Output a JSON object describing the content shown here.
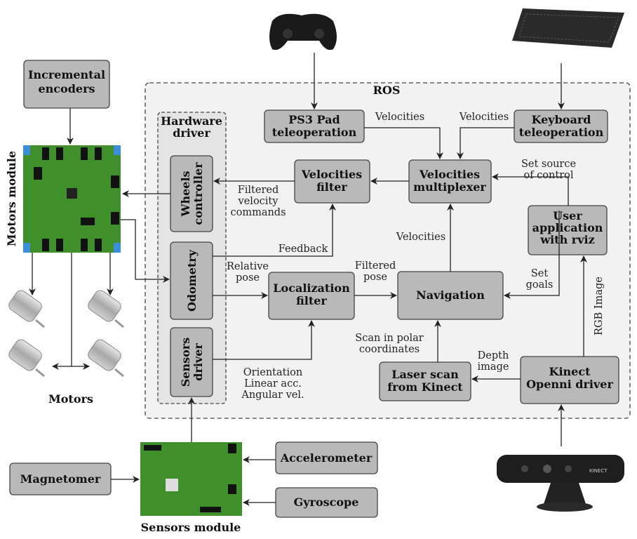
{
  "nodes": {
    "incremental_encoders": [
      "Incremental",
      "encoders"
    ],
    "motors_module": "Motors module",
    "motors": "Motors",
    "ros": "ROS",
    "hardware_driver": [
      "Hardware",
      "driver"
    ],
    "wheels_controller": [
      "Wheels",
      "controller"
    ],
    "odometry": "Odometry",
    "sensors_driver": [
      "Sensors",
      "driver"
    ],
    "ps3_pad": [
      "PS3 Pad",
      "teleoperation"
    ],
    "keyboard": [
      "Keyboard",
      "teleoperation"
    ],
    "velocities_filter": [
      "Velocities",
      "filter"
    ],
    "velocities_multiplexer": [
      "Velocities",
      "multiplexer"
    ],
    "user_application": [
      "User",
      "application",
      "with rviz"
    ],
    "localization_filter": [
      "Localization",
      "filter"
    ],
    "navigation": "Navigation",
    "laser_scan": [
      "Laser scan",
      "from Kinect"
    ],
    "kinect_driver": [
      "Kinect",
      "Openni driver"
    ],
    "sensors_module": "Sensors module",
    "magnetometer": "Magnetomer",
    "accelerometer": "Accelerometer",
    "gyroscope": "Gyroscope",
    "kinect_logo": "KINECT"
  },
  "edges": {
    "ps3_velocities": "Velocities",
    "keyboard_velocities": "Velocities",
    "set_source": [
      "Set source",
      "of control"
    ],
    "filtered_velocity": [
      "Filtered",
      "velocity",
      "commands"
    ],
    "feedback": "Feedback",
    "relative_pose": [
      "Relative",
      "pose"
    ],
    "filtered_pose": [
      "Filtered",
      "pose"
    ],
    "nav_velocities": "Velocities",
    "set_goals": [
      "Set",
      "goals"
    ],
    "rgb_image": "RGB Image",
    "scan_polar": [
      "Scan in polar",
      "coordinates"
    ],
    "depth_image": [
      "Depth",
      "image"
    ],
    "imu": [
      "Orientation",
      "Linear acc.",
      "Angular vel."
    ]
  },
  "colors": {
    "box": "#b9b9b9",
    "ros_bg": "#f2f2f2",
    "pcb": "#3f8f2a"
  }
}
